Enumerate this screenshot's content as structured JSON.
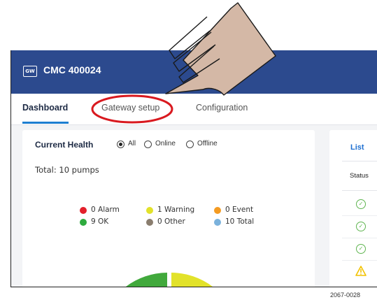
{
  "app": {
    "badge": "GW",
    "title": "CMC 400024"
  },
  "tabs": [
    {
      "label": "Dashboard",
      "active": true
    },
    {
      "label": "Gateway setup",
      "active": false,
      "highlighted": true
    },
    {
      "label": "Configuration",
      "active": false
    }
  ],
  "health": {
    "title": "Current Health",
    "filters": [
      {
        "label": "All",
        "selected": true
      },
      {
        "label": "Online",
        "selected": false
      },
      {
        "label": "Offline",
        "selected": false
      }
    ],
    "total": "Total: 10 pumps",
    "legend": [
      {
        "label": "0 Alarm",
        "color": "#e3202b"
      },
      {
        "label": "1 Warning",
        "color": "#e2e22a"
      },
      {
        "label": "0 Event",
        "color": "#f49b22"
      },
      {
        "label": "9 OK",
        "color": "#2eab3e"
      },
      {
        "label": "0 Other",
        "color": "#8a7d6e"
      },
      {
        "label": "10 Total",
        "color": "#7bb2dc"
      }
    ],
    "donut": {
      "ok_color": "#41a93c",
      "warning_color": "#e2e22a"
    }
  },
  "list": {
    "title": "List",
    "column_header": "Status",
    "statuses": [
      "ok",
      "ok",
      "ok",
      "warning"
    ]
  },
  "colors": {
    "header_bg": "#2c4a8e",
    "accent": "#1d7fd1",
    "annotation": "#d9191f",
    "hand": "#d4b8a6"
  },
  "figure_caption": "2067-0028"
}
